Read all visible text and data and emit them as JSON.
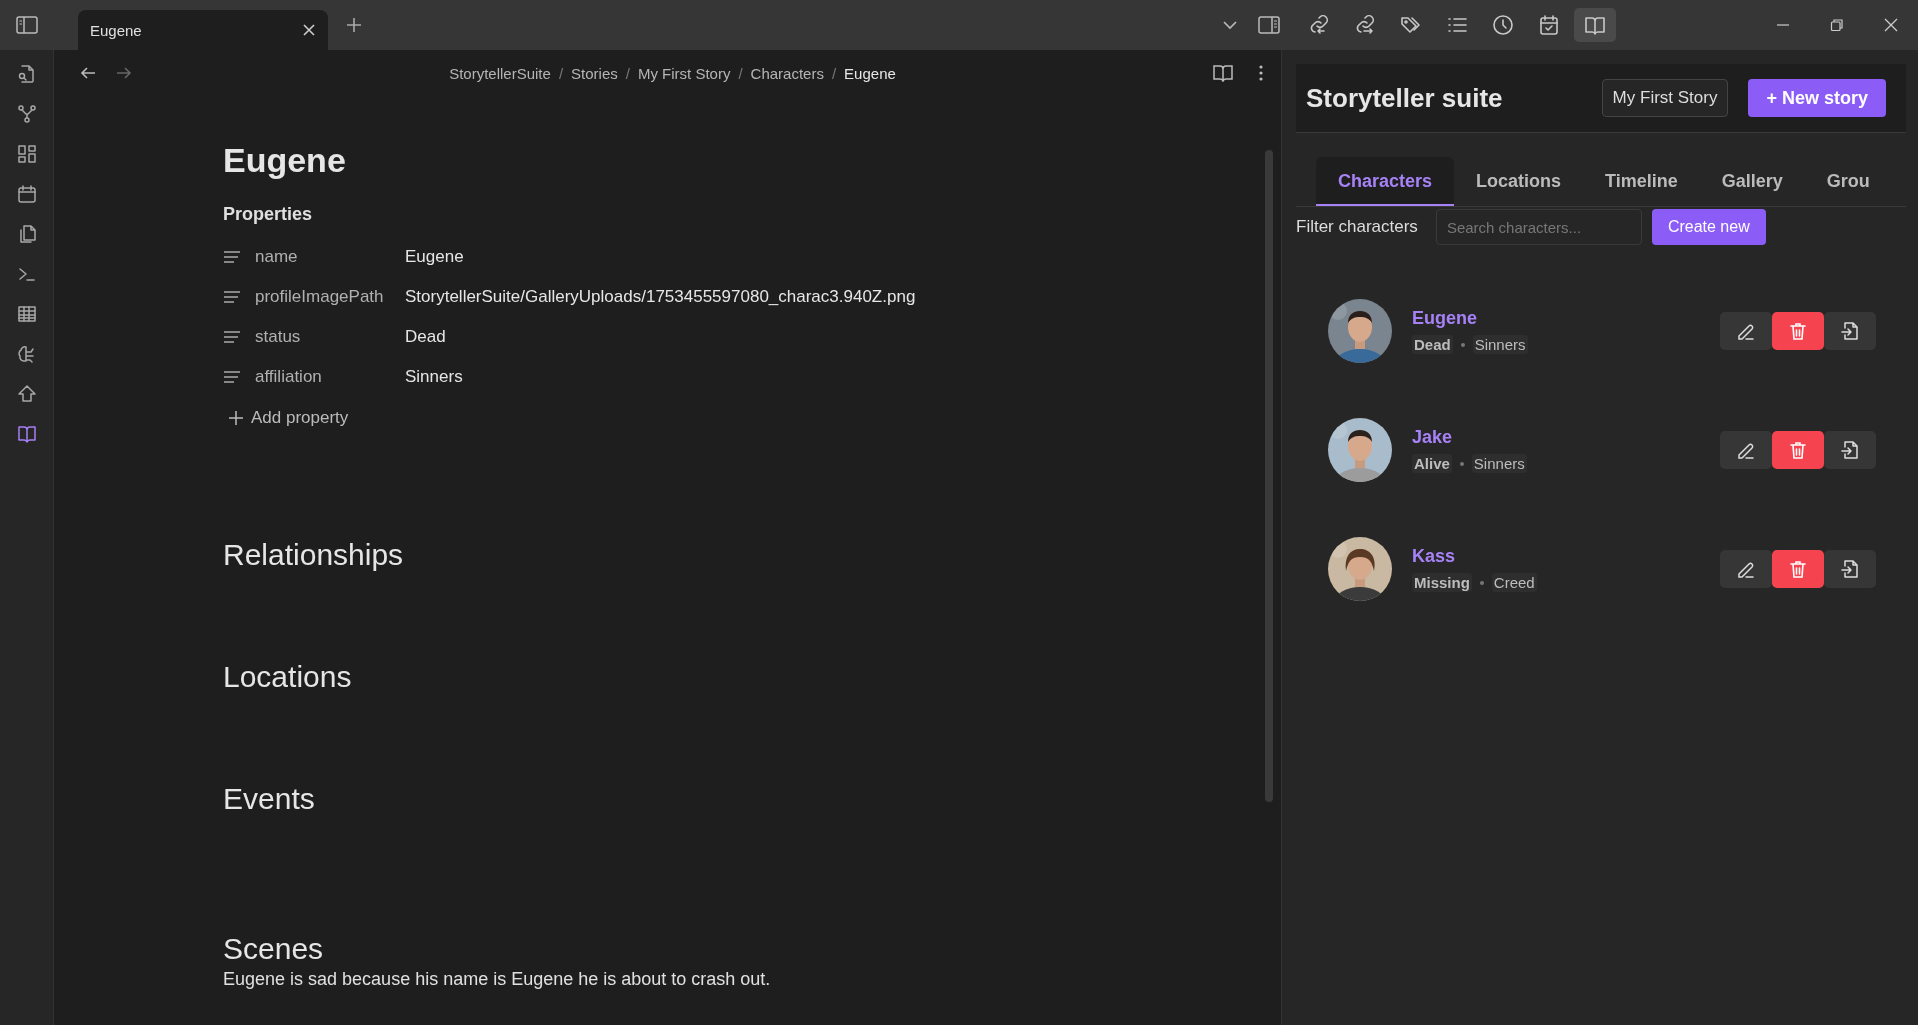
{
  "ribbon": [
    {
      "selected": false
    },
    {
      "selected": false
    },
    {
      "selected": false
    },
    {
      "selected": false
    },
    {
      "selected": false
    },
    {
      "selected": false
    },
    {
      "selected": false
    },
    {
      "selected": false
    },
    {
      "selected": false
    },
    {
      "selected": true
    }
  ],
  "tabs": [
    {
      "label": "Eugene",
      "selected": true
    }
  ],
  "toolbar": [
    {
      "selected": false
    },
    {
      "selected": false
    },
    {
      "selected": false
    },
    {
      "selected": false
    },
    {
      "selected": false
    },
    {
      "selected": false
    },
    {
      "selected": true
    }
  ],
  "breadcrumb": [
    {
      "label": "StorytellerSuite"
    },
    {
      "separator": "/",
      "label": "Stories"
    },
    {
      "separator": "/",
      "label": "My First Story"
    },
    {
      "separator": "/",
      "label": "Characters"
    },
    {
      "separator": "/",
      "label": "Eugene"
    }
  ],
  "note": {
    "title": "Eugene",
    "properties_heading": "Properties",
    "properties": [
      {
        "key": "name",
        "value": "Eugene"
      },
      {
        "key": "profileImagePath",
        "value": "StorytellerSuite/GalleryUploads/1753455597080_charac3.940Z.png"
      },
      {
        "key": "status",
        "value": "Dead"
      },
      {
        "key": "affiliation",
        "value": "Sinners"
      }
    ],
    "add_property": "Add property",
    "sections": [
      {
        "heading": "Relationships"
      },
      {
        "heading": "Locations"
      },
      {
        "heading": "Events"
      },
      {
        "heading": "Scenes",
        "text": "Eugene is sad because his name is Eugene he is about to crash out."
      }
    ]
  },
  "panel": {
    "title": "Storyteller suite",
    "story": "My First Story",
    "new_story": "+ New story",
    "tabs": [
      {
        "label": "Characters",
        "selected": true
      },
      {
        "label": "Locations",
        "selected": false
      },
      {
        "label": "Timeline",
        "selected": false
      },
      {
        "label": "Gallery",
        "selected": false
      },
      {
        "label": "Grou",
        "selected": false
      }
    ],
    "filter_label": "Filter characters",
    "search_placeholder": "Search characters...",
    "create": "Create new",
    "characters": [
      {
        "name": "Eugene",
        "status": "Dead",
        "affiliation": "Sinners"
      },
      {
        "name": "Jake",
        "status": "Alive",
        "affiliation": "Sinners"
      },
      {
        "name": "Kass",
        "status": "Missing",
        "affiliation": "Creed"
      }
    ]
  }
}
